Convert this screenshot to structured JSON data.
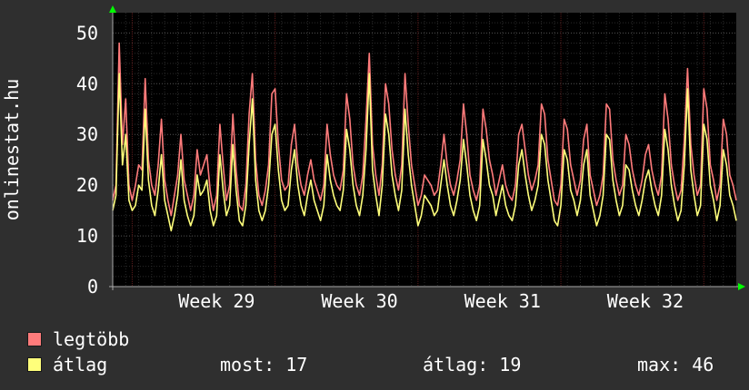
{
  "colors": {
    "background": "#2f2f2f",
    "plot_background": "#000000",
    "grid": "#3a3a3a",
    "axis_arrow": "#00ff00",
    "legtobb": "#ff7b7b",
    "atlag": "#ffff7b"
  },
  "chart_data": {
    "type": "line",
    "ylabel": "onlinestat.hu",
    "ylim": [
      0,
      54
    ],
    "yticks": [
      0,
      10,
      20,
      30,
      40,
      50
    ],
    "xlim": [
      0,
      192
    ],
    "week_labels": [
      {
        "label": "Week 29",
        "x": 32
      },
      {
        "label": "Week 30",
        "x": 76
      },
      {
        "label": "Week 31",
        "x": 120
      },
      {
        "label": "Week 32",
        "x": 164
      }
    ],
    "series": [
      {
        "name": "legtöbb",
        "color": "#ff7b7b",
        "values": [
          17,
          20,
          48,
          28,
          37,
          20,
          17,
          20,
          24,
          23,
          41,
          25,
          20,
          18,
          24,
          33,
          21,
          17,
          14,
          18,
          22,
          30,
          21,
          18,
          15,
          18,
          27,
          22,
          24,
          26,
          19,
          15,
          18,
          32,
          24,
          17,
          20,
          34,
          23,
          16,
          15,
          20,
          34,
          42,
          25,
          18,
          16,
          19,
          24,
          38,
          39,
          28,
          21,
          19,
          20,
          28,
          32,
          24,
          20,
          18,
          22,
          25,
          21,
          19,
          17,
          20,
          32,
          26,
          22,
          20,
          19,
          23,
          38,
          33,
          24,
          20,
          18,
          22,
          33,
          46,
          28,
          22,
          18,
          24,
          40,
          36,
          27,
          22,
          19,
          24,
          42,
          32,
          24,
          20,
          16,
          18,
          22,
          21,
          20,
          18,
          19,
          24,
          30,
          24,
          20,
          18,
          21,
          25,
          36,
          30,
          22,
          19,
          17,
          20,
          35,
          31,
          25,
          22,
          18,
          21,
          24,
          20,
          18,
          17,
          20,
          30,
          32,
          27,
          22,
          19,
          21,
          24,
          36,
          34,
          25,
          21,
          17,
          16,
          20,
          33,
          31,
          24,
          21,
          18,
          21,
          29,
          32,
          22,
          19,
          16,
          18,
          22,
          36,
          35,
          25,
          21,
          18,
          20,
          30,
          28,
          23,
          20,
          18,
          21,
          26,
          28,
          23,
          20,
          18,
          22,
          38,
          33,
          24,
          20,
          17,
          19,
          29,
          43,
          28,
          22,
          18,
          20,
          39,
          35,
          24,
          21,
          17,
          20,
          33,
          30,
          22,
          20,
          17
        ]
      },
      {
        "name": "átlag",
        "color": "#ffff7b",
        "values": [
          15,
          18,
          42,
          24,
          30,
          17,
          15,
          16,
          20,
          19,
          35,
          21,
          16,
          14,
          19,
          26,
          17,
          14,
          11,
          14,
          18,
          25,
          17,
          14,
          12,
          14,
          22,
          18,
          19,
          21,
          15,
          12,
          14,
          26,
          19,
          14,
          16,
          28,
          19,
          13,
          12,
          16,
          28,
          37,
          21,
          15,
          13,
          15,
          20,
          30,
          32,
          23,
          17,
          15,
          16,
          23,
          27,
          20,
          16,
          14,
          18,
          21,
          17,
          15,
          13,
          16,
          26,
          21,
          18,
          16,
          15,
          19,
          31,
          27,
          20,
          16,
          14,
          18,
          27,
          42,
          23,
          18,
          14,
          20,
          34,
          30,
          22,
          18,
          15,
          19,
          35,
          26,
          20,
          16,
          12,
          14,
          18,
          17,
          16,
          14,
          15,
          20,
          25,
          20,
          16,
          14,
          17,
          21,
          29,
          24,
          18,
          15,
          13,
          16,
          29,
          25,
          20,
          18,
          14,
          17,
          20,
          16,
          14,
          13,
          16,
          24,
          27,
          22,
          18,
          15,
          17,
          20,
          30,
          28,
          21,
          17,
          13,
          12,
          16,
          27,
          25,
          19,
          17,
          14,
          17,
          24,
          27,
          18,
          15,
          12,
          14,
          18,
          30,
          29,
          21,
          17,
          14,
          16,
          24,
          23,
          19,
          16,
          14,
          17,
          21,
          23,
          19,
          16,
          14,
          18,
          31,
          27,
          20,
          16,
          13,
          15,
          24,
          39,
          23,
          18,
          14,
          16,
          32,
          29,
          20,
          17,
          13,
          16,
          27,
          24,
          18,
          16,
          13
        ]
      }
    ]
  },
  "legend": {
    "items": [
      {
        "label": "legtöbb",
        "color": "#ff7b7b"
      },
      {
        "label": "átlag",
        "color": "#ffff7b"
      }
    ],
    "stats": {
      "most": "most: 17",
      "atlag": "átlag: 19",
      "max": "max: 46"
    }
  }
}
